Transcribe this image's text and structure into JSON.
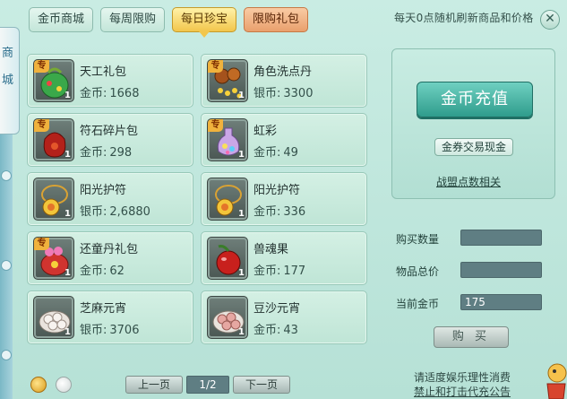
{
  "tabs": [
    {
      "label": "金币商城",
      "style": "normal"
    },
    {
      "label": "每周限购",
      "style": "normal"
    },
    {
      "label": "每日珍宝",
      "style": "active"
    },
    {
      "label": "限购礼包",
      "style": "pink"
    }
  ],
  "notice": "每天0点随机刷新商品和价格",
  "side_label": "商城",
  "items": [
    {
      "name": "天工礼包",
      "currency": "金币:",
      "price": "1668",
      "qty": "1",
      "exclusive": true,
      "icon": "green-gift-bag-icon",
      "exclusive_label": "专"
    },
    {
      "name": "角色洗点丹",
      "currency": "银币:",
      "price": "3300",
      "qty": "1",
      "exclusive": true,
      "icon": "gold-pills-icon",
      "exclusive_label": "专"
    },
    {
      "name": "符石碎片包",
      "currency": "金币:",
      "price": "298",
      "qty": "1",
      "exclusive": true,
      "icon": "red-pouch-icon",
      "exclusive_label": "专"
    },
    {
      "name": "虹彩",
      "currency": "金币:",
      "price": "49",
      "qty": "1",
      "exclusive": true,
      "icon": "rainbow-potion-icon",
      "exclusive_label": "专"
    },
    {
      "name": "阳光护符",
      "currency": "银币:",
      "price": "2,6880",
      "qty": "1",
      "exclusive": false,
      "icon": "sun-amulet-icon"
    },
    {
      "name": "阳光护符",
      "currency": "金币:",
      "price": "336",
      "qty": "1",
      "exclusive": false,
      "icon": "sun-amulet-icon"
    },
    {
      "name": "还童丹礼包",
      "currency": "金币:",
      "price": "62",
      "qty": "1",
      "exclusive": true,
      "icon": "pink-gift-pot-icon",
      "exclusive_label": "专"
    },
    {
      "name": "兽魂果",
      "currency": "金币:",
      "price": "177",
      "qty": "1",
      "exclusive": false,
      "icon": "red-fruit-icon"
    },
    {
      "name": "芝麻元宵",
      "currency": "银币:",
      "price": "3706",
      "qty": "1",
      "exclusive": false,
      "icon": "white-dumplings-icon"
    },
    {
      "name": "豆沙元宵",
      "currency": "金币:",
      "price": "43",
      "qty": "1",
      "exclusive": false,
      "icon": "pink-dumplings-icon"
    }
  ],
  "right_panel": {
    "recharge_label": "金币充值",
    "coupon_label": "金券交易现金",
    "alliance_label": "战盟点数相关"
  },
  "purchase": {
    "qty_label": "购买数量",
    "qty_value": "",
    "total_label": "物品总价",
    "total_value": "",
    "current_label": "当前金币",
    "current_value": "175",
    "buy_label": "购 买"
  },
  "pager": {
    "prev": "上一页",
    "page": "1/2",
    "next": "下一页"
  },
  "tips": [
    "请适度娱乐理性消费",
    "禁止和打击代充公告"
  ],
  "colors": {
    "accent": "#2f9c8c",
    "active_tab": "#f2c64c",
    "pink_tab": "#e9a06d",
    "field": "#5f7e83"
  }
}
